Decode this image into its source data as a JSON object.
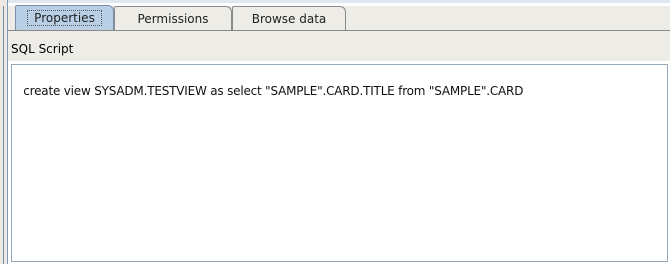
{
  "tabs": [
    {
      "label": "Properties",
      "active": true
    },
    {
      "label": "Permissions",
      "active": false
    },
    {
      "label": "Browse data",
      "active": false
    }
  ],
  "section": {
    "title": "SQL Script"
  },
  "editor": {
    "content": "create view SYSADM.TESTVIEW as select \"SAMPLE\".CARD.TITLE from \"SAMPLE\".CARD"
  },
  "colors": {
    "active_tab": "#b8cfe5",
    "panel_bg": "#eeece6",
    "editor_bg": "#ffffff"
  }
}
